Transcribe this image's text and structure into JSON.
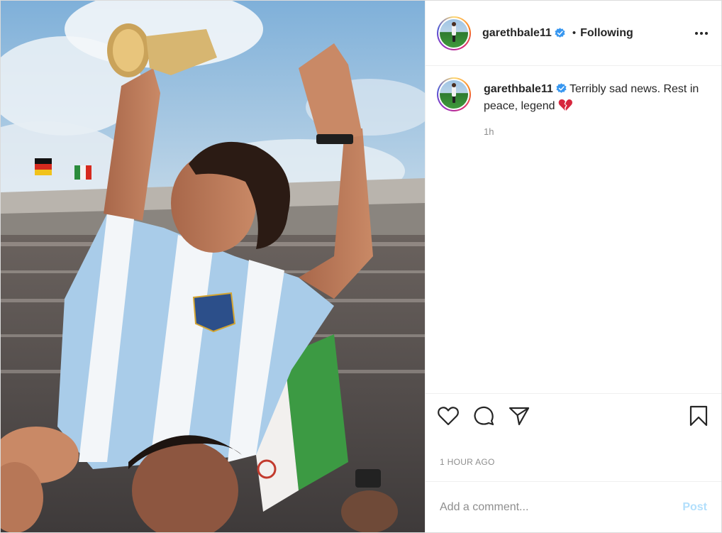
{
  "post": {
    "photo": {
      "alt": ""
    },
    "header": {
      "username": "garethbale11",
      "separator": "•",
      "follow_status": "Following"
    },
    "caption": {
      "username": "garethbale11",
      "text": "Terribly sad news. Rest in peace, legend",
      "emoji": "broken-heart-emoji",
      "relative_time": "1h"
    },
    "actions": {
      "icons": [
        "heart-icon",
        "comment-icon",
        "share-icon",
        "bookmark-icon"
      ]
    },
    "timestamp": "1 HOUR AGO",
    "comment": {
      "placeholder": "Add a comment...",
      "post_label": "Post"
    }
  },
  "colors": {
    "verified_blue": "#3897f0",
    "post_button_disabled": "#b2dffc",
    "muted_text": "#8e8e8e",
    "border": "#efefef",
    "heart_red": "#ed4956"
  }
}
